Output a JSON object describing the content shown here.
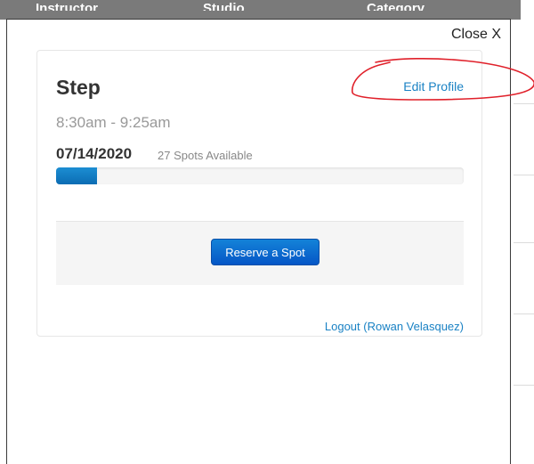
{
  "background_header": {
    "columns": [
      "Instructor",
      "Studio",
      "Category"
    ]
  },
  "modal": {
    "close_label": "Close X"
  },
  "class_card": {
    "title": "Step",
    "edit_profile_label": "Edit Profile",
    "time": "8:30am - 9:25am",
    "date": "07/14/2020",
    "spots_available": "27 Spots Available",
    "progress_fraction": 0.1,
    "reserve_label": "Reserve a Spot",
    "logout_label": "Logout (Rowan Velasquez)"
  },
  "colors": {
    "link": "#1a82c4",
    "button": "#0556c6",
    "annotation": "#e0202a"
  }
}
